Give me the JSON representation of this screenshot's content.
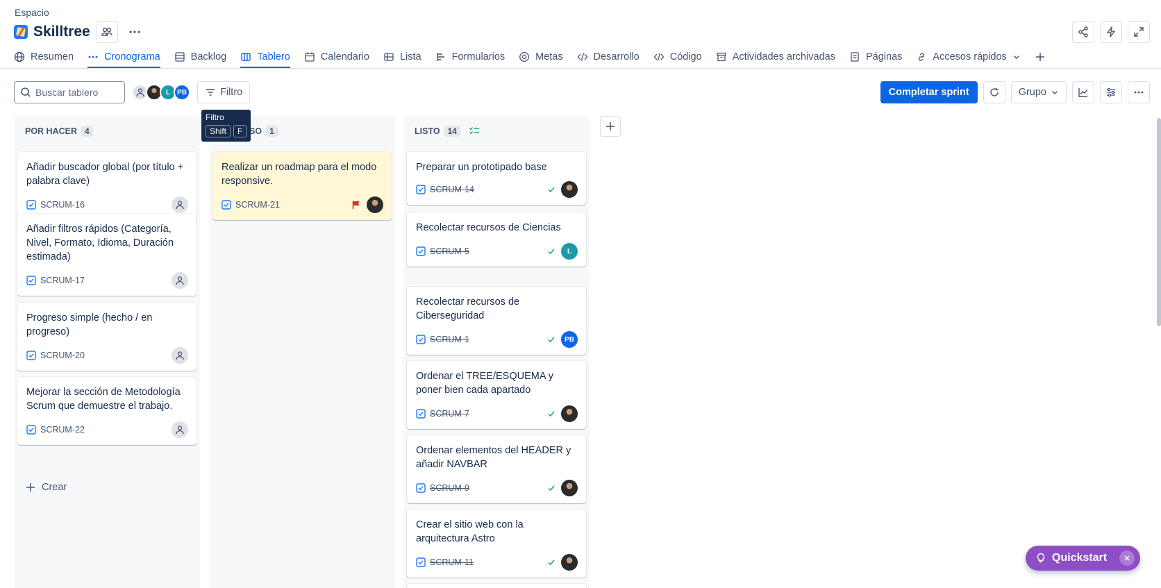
{
  "breadcrumb": "Espacio",
  "project": {
    "name": "Skilltree"
  },
  "tabs": [
    {
      "label": "Resumen",
      "icon": "globe-icon"
    },
    {
      "label": "Cronograma",
      "icon": "timeline-icon"
    },
    {
      "label": "Backlog",
      "icon": "backlog-icon"
    },
    {
      "label": "Tablero",
      "icon": "board-icon"
    },
    {
      "label": "Calendario",
      "icon": "calendar-icon"
    },
    {
      "label": "Lista",
      "icon": "list-icon"
    },
    {
      "label": "Formularios",
      "icon": "forms-icon"
    },
    {
      "label": "Metas",
      "icon": "goal-icon"
    },
    {
      "label": "Desarrollo",
      "icon": "code-icon"
    },
    {
      "label": "Código",
      "icon": "code-icon"
    },
    {
      "label": "Actividades archivadas",
      "icon": "archive-icon"
    },
    {
      "label": "Páginas",
      "icon": "page-icon"
    },
    {
      "label": "Accesos rápidos",
      "icon": "link-icon"
    }
  ],
  "toolbar": {
    "search_placeholder": "Buscar tablero",
    "filter_label": "Filtro",
    "complete_sprint": "Completar sprint",
    "group_label": "Grupo",
    "avatars": [
      "unassigned",
      "photo",
      "L",
      "PB"
    ]
  },
  "tooltip": {
    "title": "Filtro",
    "key1": "Shift",
    "key2": "F"
  },
  "columns": [
    {
      "name": "POR HACER",
      "count": "4",
      "cards": [
        {
          "title": "Añadir buscador global (por título + palabra clave)",
          "key": "SCRUM-16"
        },
        {
          "title": "Añadir filtros rápidos (Categoría, Nivel, Formato, Idioma, Duración estimada)",
          "key": "SCRUM-17"
        },
        {
          "title": "Progreso simple (hecho / en progreso)",
          "key": "SCRUM-20"
        },
        {
          "title": "Mejorar la sección de Metodología Scrum que demuestre el trabajo.",
          "key": "SCRUM-22"
        }
      ],
      "create_label": "Crear"
    },
    {
      "name": "SO",
      "count": "1",
      "cards": [
        {
          "title": "Realizar un roadmap para el modo responsive.",
          "key": "SCRUM-21"
        }
      ]
    },
    {
      "name": "LISTO",
      "count": "14",
      "cards": [
        {
          "title": "Preparar un prototipado base",
          "key": "SCRUM-14",
          "assignee": "photo"
        },
        {
          "title": "Recolectar recursos de Ciencias",
          "key": "SCRUM-5",
          "assignee": "L"
        },
        {
          "title": "Recolectar recursos de Ciberseguridad",
          "key": "SCRUM-1",
          "assignee": "PB"
        },
        {
          "title": "Ordenar el TREE/ESQUEMA y poner bien cada apartado",
          "key": "SCRUM-7",
          "assignee": "photo"
        },
        {
          "title": "Ordenar elementos del HEADER y añadir NAVBAR",
          "key": "SCRUM-9",
          "assignee": "photo"
        },
        {
          "title": "Crear el sitio web con la arquitectura Astro",
          "key": "SCRUM-11",
          "assignee": "photo"
        }
      ]
    }
  ],
  "quickstart": {
    "label": "Quickstart"
  },
  "colors": {
    "accent": "#0c66e4",
    "quickstart": "#8e4ec6",
    "flag": "#c9372c",
    "done_check": "#22a06b"
  }
}
